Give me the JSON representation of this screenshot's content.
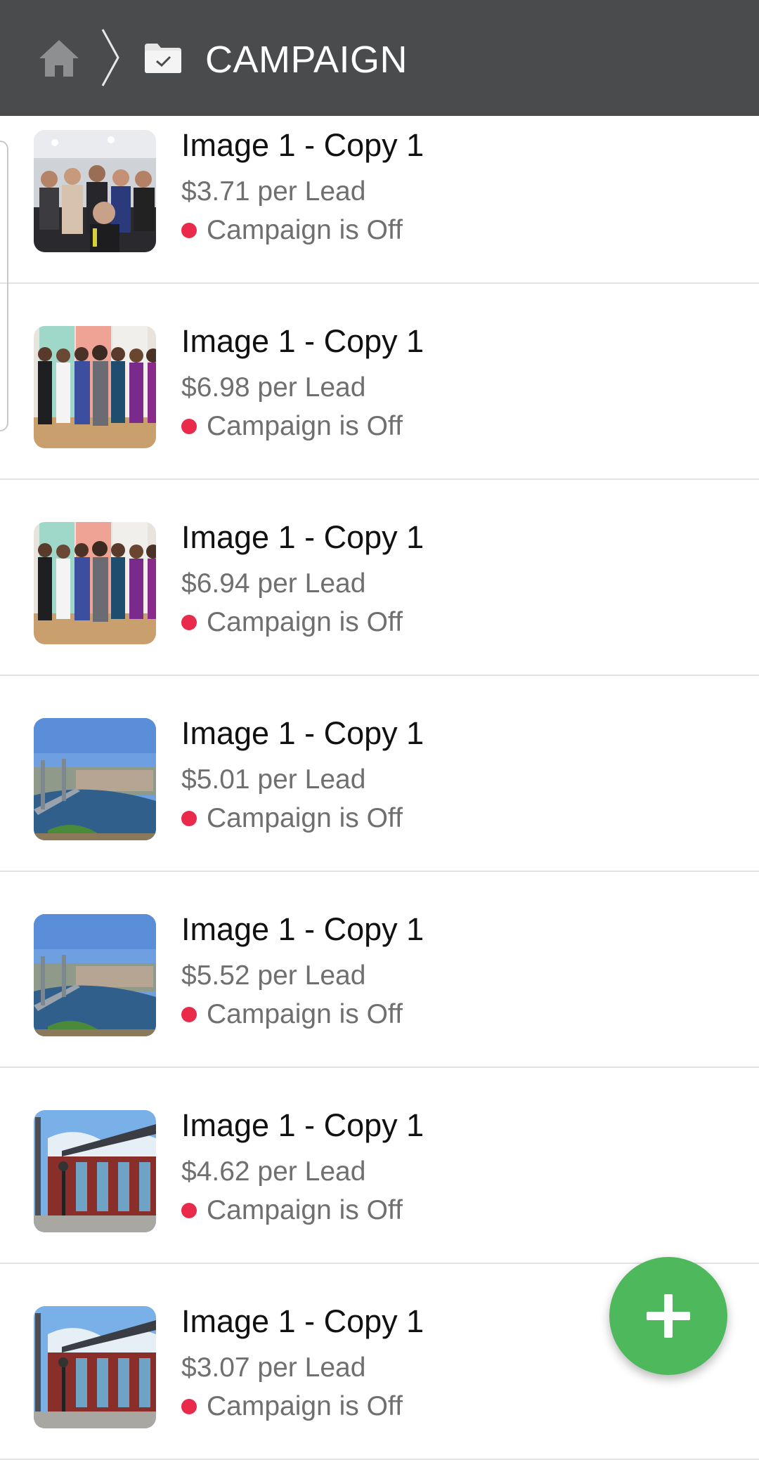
{
  "header": {
    "title": "CAMPAIGN",
    "home_icon": "home-icon",
    "separator_icon": "chevron-right-icon",
    "folder_icon": "folder-check-icon",
    "background": "#4a4b4d"
  },
  "campaigns": [
    {
      "name": "Image 1 - Copy 1",
      "price": "$3.71 per Lead",
      "status": "Campaign is Off",
      "thumb": "gym-group"
    },
    {
      "name": "Image 1 - Copy 1",
      "price": "$6.98 per Lead",
      "status": "Campaign is Off",
      "thumb": "women-doors"
    },
    {
      "name": "Image 1 - Copy 1",
      "price": "$6.94 per Lead",
      "status": "Campaign is Off",
      "thumb": "women-doors"
    },
    {
      "name": "Image 1 - Copy 1",
      "price": "$5.01 per Lead",
      "status": "Campaign is Off",
      "thumb": "river-town"
    },
    {
      "name": "Image 1 - Copy 1",
      "price": "$5.52 per Lead",
      "status": "Campaign is Off",
      "thumb": "river-town"
    },
    {
      "name": "Image 1 - Copy 1",
      "price": "$4.62 per Lead",
      "status": "Campaign is Off",
      "thumb": "street-building"
    },
    {
      "name": "Image 1 - Copy 1",
      "price": "$3.07 per Lead",
      "status": "Campaign is Off",
      "thumb": "street-building"
    }
  ],
  "status_color": "#ea2a4b",
  "fab": {
    "icon": "plus-icon",
    "color": "#4eb85c"
  }
}
